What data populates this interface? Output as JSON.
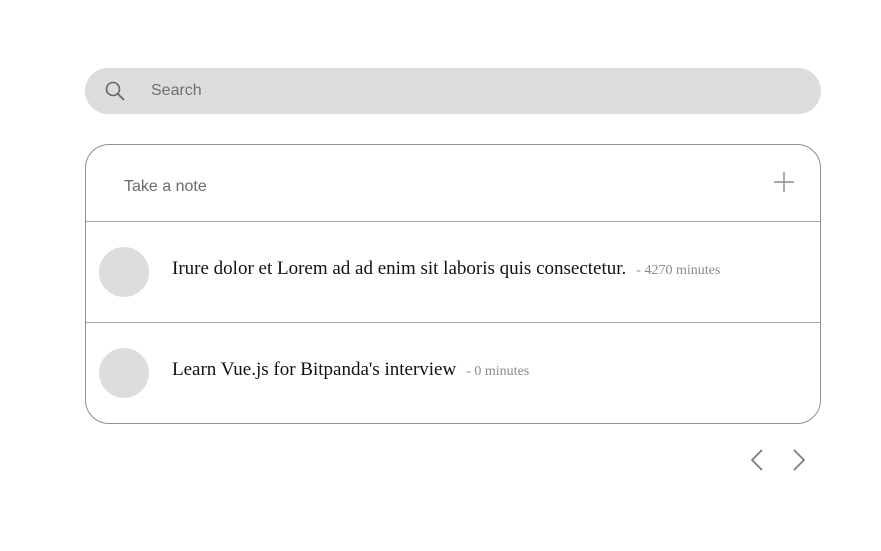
{
  "search": {
    "placeholder": "Search",
    "icon": "search-icon"
  },
  "new_note": {
    "placeholder": "Take a note",
    "add_icon": "plus-icon"
  },
  "notes": [
    {
      "text": "Irure dolor et Lorem ad ad enim sit laboris quis consectetur.",
      "time": "- 4270 minutes"
    },
    {
      "text": "Learn Vue.js for Bitpanda's interview",
      "time": "- 0 minutes"
    }
  ],
  "pagination": {
    "prev_icon": "chevron-left-icon",
    "next_icon": "chevron-right-icon"
  },
  "colors": {
    "search_bg": "#dcdcde",
    "avatar_bg": "#dddddd",
    "border": "#8e8e8e"
  }
}
